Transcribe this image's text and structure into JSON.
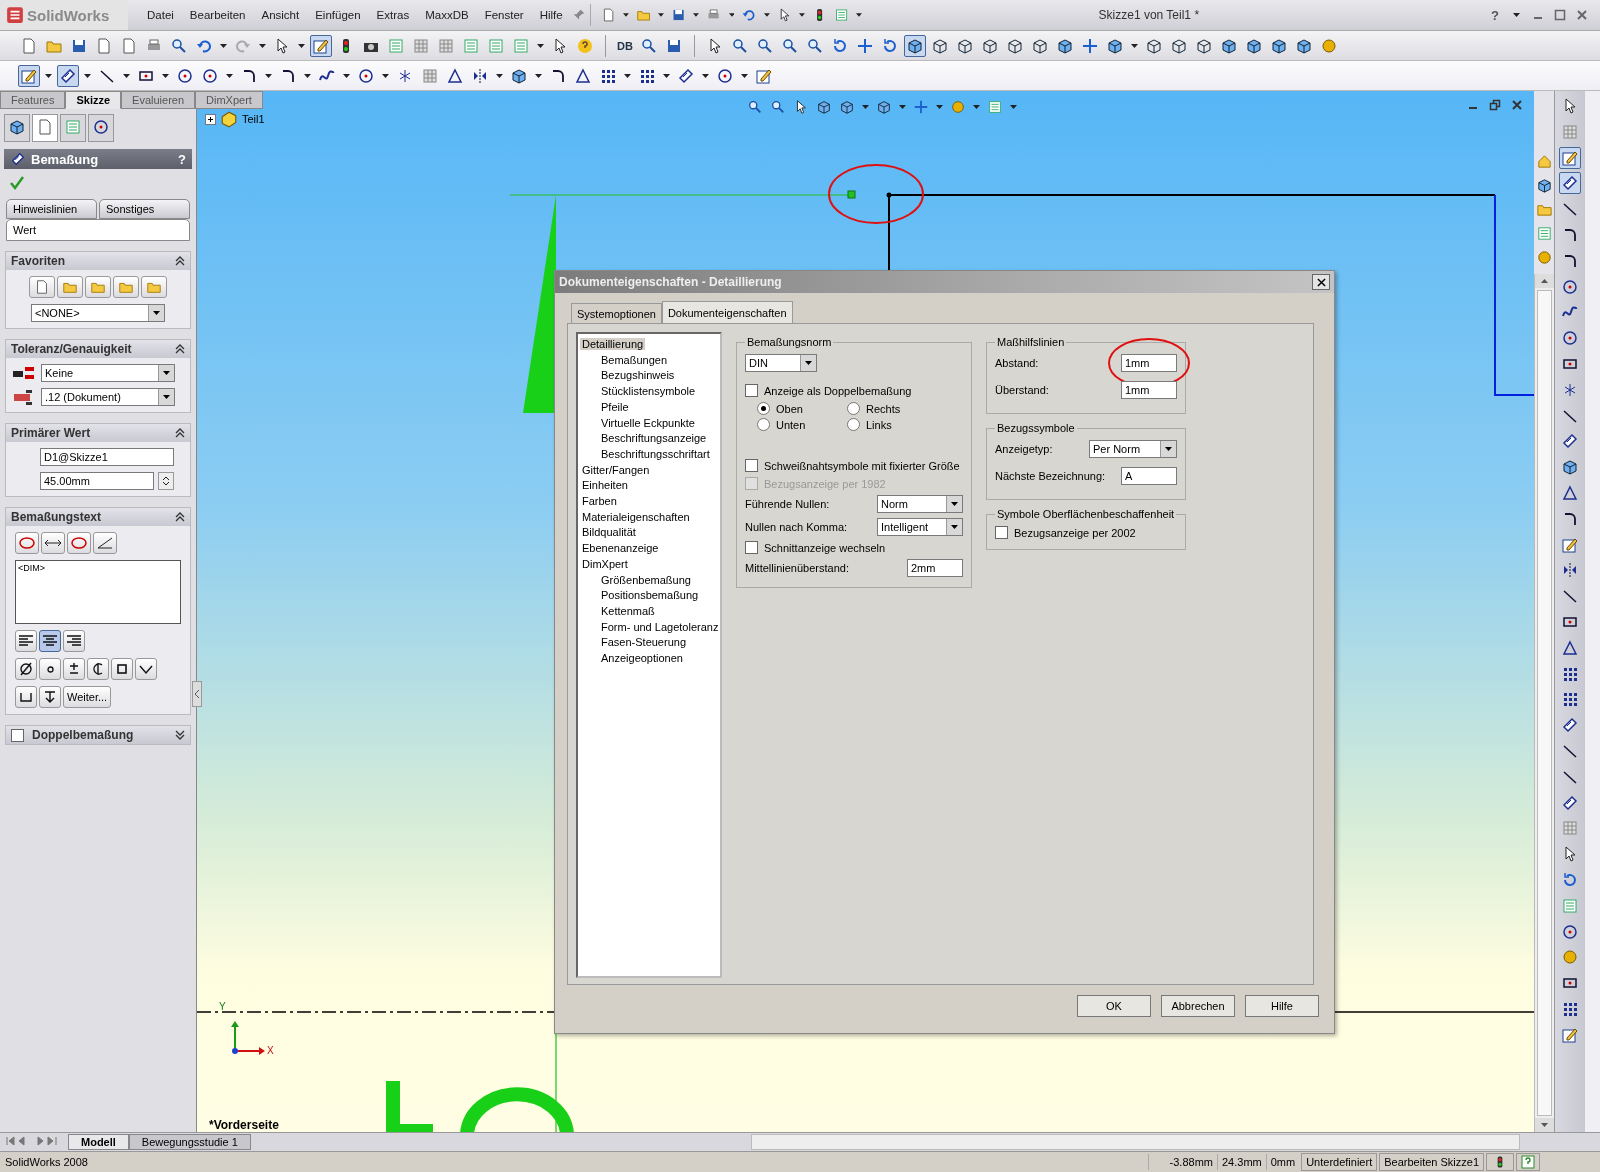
{
  "app": {
    "logo": "SolidWorks",
    "menus": [
      "Datei",
      "Bearbeiten",
      "Ansicht",
      "Einfügen",
      "Extras",
      "MaxxDB",
      "Fenster",
      "Hilfe"
    ],
    "title": "Skizze1 von Teil1 *",
    "help": "?",
    "db_label": "DB"
  },
  "toolbars": {
    "sketch_on": true,
    "dimension_on": true,
    "shaded_on": true
  },
  "manager_tabs": [
    {
      "label": "Features",
      "selected": false
    },
    {
      "label": "Skizze",
      "selected": true
    },
    {
      "label": "Evaluieren",
      "selected": false
    },
    {
      "label": "DimXpert",
      "selected": false
    }
  ],
  "property_manager": {
    "title": "Bemaßung",
    "help": "?",
    "tabs": [
      {
        "label": "Hinweislinien",
        "selected": false
      },
      {
        "label": "Sonstiges",
        "selected": false
      },
      {
        "label": "Wert",
        "selected": true
      }
    ],
    "favorites": {
      "title": "Favoriten",
      "value": "<NONE>"
    },
    "tolerance": {
      "title": "Toleranz/Genauigkeit",
      "type": "Keine",
      "precision": ".12 (Dokument)"
    },
    "primary_value": {
      "title": "Primärer Wert",
      "name": "D1@Skizze1",
      "value": "45.00mm"
    },
    "dimension_text": {
      "title": "Bemaßungstext",
      "text": "<DIM>",
      "alignments": [
        {
          "selected": false
        },
        {
          "selected": true
        },
        {
          "selected": false
        }
      ],
      "more": "Weiter..."
    },
    "dual_dimension": {
      "title": "Doppelbemaßung",
      "checked": false
    }
  },
  "feature_tree": {
    "root": "Teil1",
    "expanded": false
  },
  "canvas": {
    "point_highlighted": true,
    "triad": [
      "Y",
      "X"
    ],
    "view_label": "*Vorderseite"
  },
  "dialog": {
    "title": "Dokumenteigenschaften - Detaillierung",
    "tabs": [
      {
        "label": "Systemoptionen",
        "selected": false
      },
      {
        "label": "Dokumenteigenschaften",
        "selected": true
      }
    ],
    "tree": [
      {
        "label": "Detaillierung",
        "selected": true,
        "children": [
          {
            "label": "Bemaßungen",
            "selected": false
          },
          {
            "label": "Bezugshinweis",
            "selected": false
          },
          {
            "label": "Stücklistensymbole",
            "selected": false
          },
          {
            "label": "Pfeile",
            "selected": false
          },
          {
            "label": "Virtuelle Eckpunkte",
            "selected": false
          },
          {
            "label": "Beschriftungsanzeige",
            "selected": false
          },
          {
            "label": "Beschriftungsschriftart",
            "selected": false
          }
        ]
      },
      {
        "label": "Gitter/Fangen",
        "selected": false
      },
      {
        "label": "Einheiten",
        "selected": false
      },
      {
        "label": "Farben",
        "selected": false
      },
      {
        "label": "Materialeigenschaften",
        "selected": false
      },
      {
        "label": "Bildqualität",
        "selected": false
      },
      {
        "label": "Ebenenanzeige",
        "selected": false
      },
      {
        "label": "DimXpert",
        "selected": false,
        "children": [
          {
            "label": "Größenbemaßung",
            "selected": false
          },
          {
            "label": "Positionsbemaßung",
            "selected": false
          },
          {
            "label": "Kettenmaß",
            "selected": false
          },
          {
            "label": "Form- und Lagetoleranz",
            "selected": false
          },
          {
            "label": "Fasen-Steuerung",
            "selected": false
          },
          {
            "label": "Anzeigeoptionen",
            "selected": false
          }
        ]
      }
    ],
    "dimension_standard": {
      "title": "Bemaßungsnorm",
      "standard": "DIN",
      "dual": {
        "label": "Anzeige als Doppelbemaßung",
        "checked": false,
        "disabled": false
      },
      "positions": [
        {
          "label": "Oben",
          "selected": true
        },
        {
          "label": "Rechts",
          "selected": false
        },
        {
          "label": "Unten",
          "selected": false
        },
        {
          "label": "Links",
          "selected": false
        }
      ],
      "weld": {
        "label": "Schweißnahtsymbole mit fixierter Größe",
        "checked": false,
        "disabled": false
      },
      "datum_1982": {
        "label": "Bezugsanzeige per 1982",
        "checked": false,
        "disabled": true
      },
      "leading_zeros": {
        "label": "Führende Nullen:",
        "value": "Norm"
      },
      "trailing_zeros": {
        "label": "Nullen nach Komma:",
        "value": "Intelligent"
      },
      "section_toggle": {
        "label": "Schnittanzeige wechseln",
        "checked": false,
        "disabled": false
      },
      "centerline": {
        "label": "Mittellinienüberstand:",
        "value": "2mm"
      }
    },
    "extension_lines": {
      "title": "Maßhilfslinien",
      "gap": {
        "label": "Abstand:",
        "value": "1mm",
        "highlighted": true
      },
      "overshoot": {
        "label": "Überstand:",
        "value": "1mm"
      }
    },
    "datum_symbols": {
      "title": "Bezugssymbole",
      "display": {
        "label": "Anzeigetyp:",
        "value": "Per Norm"
      },
      "next": {
        "label": "Nächste Bezeichnung:",
        "value": "A"
      }
    },
    "surface_symbols": {
      "title": "Symbole Oberflächenbeschaffenheit",
      "datum_2002": {
        "label": "Bezugsanzeige per 2002",
        "checked": false,
        "disabled": false
      }
    },
    "buttons": [
      "OK",
      "Abbrechen",
      "Hilfe"
    ]
  },
  "bottom_tabs": [
    {
      "label": "Modell",
      "selected": true
    },
    {
      "label": "Bewegungsstudie 1",
      "selected": false
    }
  ],
  "status_bar": {
    "app": "SolidWorks 2008",
    "x": "-3.88mm",
    "y": "24.3mm",
    "z": "0mm",
    "state": "Unterdefiniert",
    "mode": "Bearbeiten Skizze1"
  }
}
